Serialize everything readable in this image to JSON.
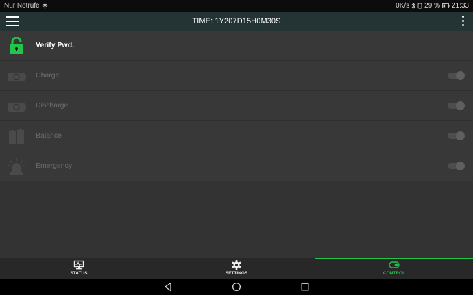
{
  "status_bar": {
    "carrier": "Nur Notrufe",
    "speed": "0K/s",
    "battery": "29 %",
    "time": "21:33"
  },
  "app_bar": {
    "title": "TIME: 1Y207D15H0M30S"
  },
  "control_list": [
    {
      "label": "Verify Pwd.",
      "icon": "lock-icon",
      "enabled": true
    },
    {
      "label": "Charge",
      "icon": "charge-icon",
      "enabled": false,
      "toggle_on": false
    },
    {
      "label": "Discharge",
      "icon": "discharge-icon",
      "enabled": false,
      "toggle_on": false
    },
    {
      "label": "Balance",
      "icon": "balance-icon",
      "enabled": false,
      "toggle_on": false
    },
    {
      "label": "Emergency",
      "icon": "emergency-icon",
      "enabled": false,
      "toggle_on": false
    }
  ],
  "bottom_nav": [
    {
      "label": "STATUS",
      "icon": "status-icon",
      "selected": false
    },
    {
      "label": "SETTINGS",
      "icon": "gear-icon",
      "selected": false
    },
    {
      "label": "CONTROL",
      "icon": "toggle-icon",
      "selected": true
    }
  ],
  "colors": {
    "accent": "#21c24a",
    "background": "#333333",
    "app_bar": "#243333",
    "row": "#383838"
  }
}
